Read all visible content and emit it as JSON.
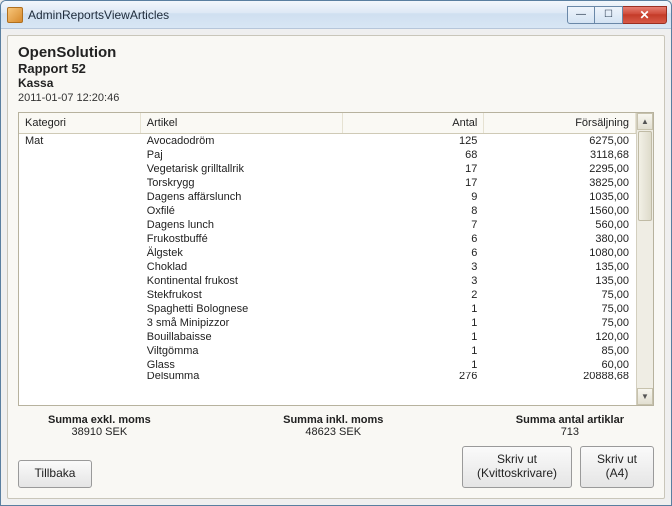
{
  "window": {
    "title": "AdminReportsViewArticles"
  },
  "header": {
    "company": "OpenSolution",
    "report": "Rapport 52",
    "register": "Kassa",
    "timestamp": "2011-01-07 12:20:46"
  },
  "table": {
    "columns": {
      "category": "Kategori",
      "article": "Artikel",
      "count": "Antal",
      "sales": "Försäljning"
    },
    "category": "Mat",
    "rows": [
      {
        "article": "Avocadodröm",
        "count": "125",
        "sales": "6275,00"
      },
      {
        "article": "Paj",
        "count": "68",
        "sales": "3118,68"
      },
      {
        "article": "Vegetarisk grilltallrik",
        "count": "17",
        "sales": "2295,00"
      },
      {
        "article": "Torskrygg",
        "count": "17",
        "sales": "3825,00"
      },
      {
        "article": "Dagens affärslunch",
        "count": "9",
        "sales": "1035,00"
      },
      {
        "article": "Oxfilé",
        "count": "8",
        "sales": "1560,00"
      },
      {
        "article": "Dagens lunch",
        "count": "7",
        "sales": "560,00"
      },
      {
        "article": "Frukostbuffé",
        "count": "6",
        "sales": "380,00"
      },
      {
        "article": "Älgstek",
        "count": "6",
        "sales": "1080,00"
      },
      {
        "article": "Choklad",
        "count": "3",
        "sales": "135,00"
      },
      {
        "article": "Kontinental frukost",
        "count": "3",
        "sales": "135,00"
      },
      {
        "article": "Stekfrukost",
        "count": "2",
        "sales": "75,00"
      },
      {
        "article": "Spaghetti Bolognese",
        "count": "1",
        "sales": "75,00"
      },
      {
        "article": "3 små Minipizzor",
        "count": "1",
        "sales": "75,00"
      },
      {
        "article": "Bouillabaisse",
        "count": "1",
        "sales": "120,00"
      },
      {
        "article": "Viltgömma",
        "count": "1",
        "sales": "85,00"
      },
      {
        "article": "Glass",
        "count": "1",
        "sales": "60,00"
      },
      {
        "article": "Delsumma",
        "count": "276",
        "sales": "20888,68"
      }
    ]
  },
  "summary": {
    "ex_vat_label": "Summa exkl. moms",
    "ex_vat_value": "38910 SEK",
    "inc_vat_label": "Summa inkl. moms",
    "inc_vat_value": "48623 SEK",
    "count_label": "Summa antal artiklar",
    "count_value": "713"
  },
  "buttons": {
    "back": "Tillbaka",
    "print_receipt_l1": "Skriv ut",
    "print_receipt_l2": "(Kvittoskrivare)",
    "print_a4_l1": "Skriv ut",
    "print_a4_l2": "(A4)"
  }
}
